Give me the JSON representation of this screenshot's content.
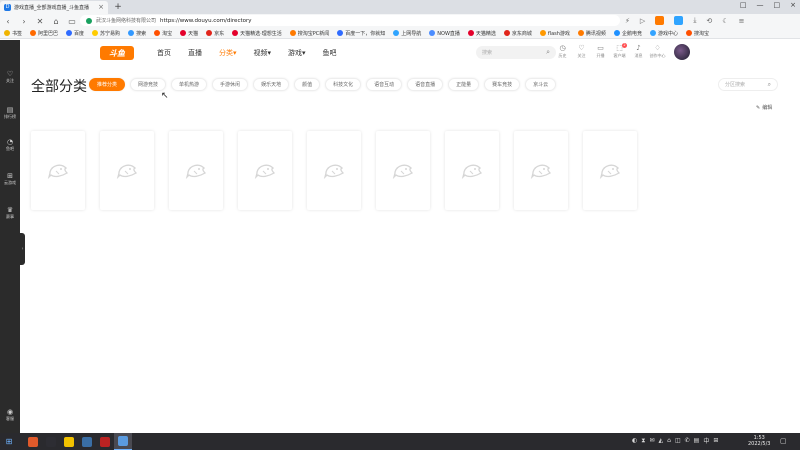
{
  "browser": {
    "tab_title": "游戏直播_全部游戏直播_斗鱼直播",
    "tab_close": "×",
    "new_tab": "+",
    "window_controls": [
      "□",
      "—",
      "□",
      "×"
    ],
    "nav": {
      "back": "‹",
      "forward": "›",
      "stop": "✕",
      "home": "⌂",
      "reader": "▭"
    },
    "address": {
      "site_name": "武汉斗鱼网络科技有限公司",
      "url": "https://www.douyu.com/directory"
    },
    "toolbar_right": [
      "⚡",
      "▷",
      "⊙",
      "✉",
      "⤓",
      "⟲",
      "☾",
      "≡"
    ]
  },
  "bookmarks": [
    {
      "label": "书签",
      "color": "#f0b400"
    },
    {
      "label": "阿里巴巴",
      "color": "#ff6a00"
    },
    {
      "label": "百度",
      "color": "#2f6bff"
    },
    {
      "label": "苏宁易购",
      "color": "#ffcc00"
    },
    {
      "label": "搜索",
      "color": "#3399ff"
    },
    {
      "label": "淘宝",
      "color": "#ff5000"
    },
    {
      "label": "天猫",
      "color": "#e4002b"
    },
    {
      "label": "京东",
      "color": "#e1251b"
    },
    {
      "label": "天猫精选·理想生活",
      "color": "#e4002b"
    },
    {
      "label": "搜淘宝PC新闻",
      "color": "#ff7a00"
    },
    {
      "label": "百度一下，你就知",
      "color": "#2f6bff"
    },
    {
      "label": "上网导航",
      "color": "#2fa4ff"
    },
    {
      "label": "NOW直播",
      "color": "#4c8dff"
    },
    {
      "label": "天猫精选",
      "color": "#e4002b"
    },
    {
      "label": "京东商城",
      "color": "#e1251b"
    },
    {
      "label": "flash游戏",
      "color": "#ff9900"
    },
    {
      "label": "腾讯视频",
      "color": "#ff7a00"
    },
    {
      "label": "企鹅电竞",
      "color": "#1e90ff"
    },
    {
      "label": "游戏中心",
      "color": "#33a3ff"
    },
    {
      "label": "搜淘宝",
      "color": "#ff5000"
    }
  ],
  "sidebar": [
    {
      "icon": "♡",
      "label": "关注"
    },
    {
      "icon": "▤",
      "label": "排行榜"
    },
    {
      "icon": "◔",
      "label": "鱼吧"
    },
    {
      "icon": "⊞",
      "label": "云游戏"
    },
    {
      "icon": "♛",
      "label": "赛事"
    },
    {
      "icon": "◉",
      "label": "客服"
    }
  ],
  "sidebar_toggle": "›",
  "header": {
    "logo_text": "斗鱼",
    "nav": [
      "首页",
      "直播",
      "分类▾",
      "视频▾",
      "游戏▾",
      "鱼吧"
    ],
    "active_nav_index": 2,
    "search_placeholder": "搜索",
    "search_icon": "⌕",
    "icons": [
      {
        "icon": "◷",
        "label": "历史"
      },
      {
        "icon": "♡",
        "label": "关注"
      },
      {
        "icon": "▭",
        "label": "开播"
      },
      {
        "icon": "⬚",
        "label": "客户端",
        "badge": "2"
      },
      {
        "icon": "♪",
        "label": "消息"
      },
      {
        "icon": "♢",
        "label": "创作中心"
      }
    ]
  },
  "page": {
    "title": "全部分类",
    "categories": [
      "推荐分类",
      "网游竞技",
      "单机热游",
      "手游休闲",
      "娱乐天地",
      "颜值",
      "科技文化",
      "语音互动",
      "语音直播",
      "正能量",
      "赛车竞技",
      "京斗云"
    ],
    "active_category_index": 0,
    "category_search_placeholder": "分区搜索",
    "category_search_icon": "⌕",
    "edit_label": "编辑",
    "edit_icon": "✎",
    "card_count_placeholder": [
      "",
      "",
      "",
      "",
      "",
      "",
      "",
      "",
      ""
    ]
  },
  "taskbar": {
    "start_icon": "⊞",
    "apps": [
      {
        "color": "#e05a2b"
      },
      {
        "color": "#2d2d33"
      },
      {
        "color": "#f2c200"
      },
      {
        "color": "#3a6ea5"
      },
      {
        "color": "#b22"
      },
      {
        "color": "#5a9be0",
        "active": true
      }
    ],
    "tray_icons": [
      "◐",
      "⧗",
      "✉",
      "◭",
      "⌂",
      "◫",
      "✆",
      "▤",
      "中",
      "⊞"
    ],
    "time": "1:53",
    "date": "2022/5/3",
    "notification_icon": "▢"
  },
  "colors": {
    "accent": "#ff7a00",
    "sidebar_bg": "#2b2b2b",
    "taskbar_bg": "#2a2a2e"
  }
}
